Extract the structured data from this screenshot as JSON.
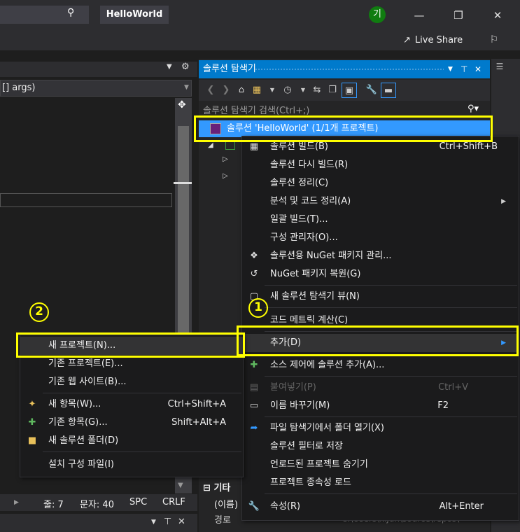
{
  "window": {
    "title": "HelloWorld",
    "user_initial": "기",
    "live_share": "Live Share",
    "minimize": "—",
    "restore": "❐",
    "close": "✕"
  },
  "editor": {
    "nav_combo": "[] args)",
    "status": {
      "line": "줄: 7",
      "char": "문자: 40",
      "spc": "SPC",
      "crlf": "CRLF"
    }
  },
  "solution_explorer": {
    "title": "솔루션 탐색기",
    "search_placeholder": "솔루션 탐색기 검색(Ctrl+;)",
    "solution_label": "솔루션 'HelloWorld' (1/1개 프로젝트)",
    "properties": {
      "group": "기타",
      "name_label": "(이름)",
      "path_label": "경로",
      "path_value": "C:\\Users\\kijun\\source\\repos\\"
    }
  },
  "context_menu": {
    "items": [
      {
        "label": "솔루션 빌드(B)",
        "shortcut": "Ctrl+Shift+B",
        "icon": "build-icon"
      },
      {
        "label": "솔루션 다시 빌드(R)",
        "shortcut": ""
      },
      {
        "label": "솔루션 정리(C)",
        "shortcut": ""
      },
      {
        "label": "분석 및 코드 정리(A)",
        "shortcut": "",
        "submenu": true
      },
      {
        "label": "일괄 빌드(T)...",
        "shortcut": ""
      },
      {
        "label": "구성 관리자(O)...",
        "shortcut": ""
      },
      {
        "label": "솔루션용 NuGet 패키지 관리...",
        "shortcut": "",
        "icon": "nuget-icon"
      },
      {
        "label": "NuGet 패키지 복원(G)",
        "shortcut": "",
        "icon": "nuget-restore-icon"
      },
      {
        "label": "새 솔루션 탐색기 뷰(N)",
        "shortcut": "",
        "icon": "new-view-icon"
      },
      {
        "label": "코드 메트릭 계산(C)",
        "shortcut": ""
      },
      {
        "label": "추가(D)",
        "shortcut": "",
        "submenu": true
      },
      {
        "label": "소스 제어에 솔루션 추가(A)...",
        "shortcut": "",
        "icon": "source-control-icon"
      },
      {
        "label": "붙여넣기(P)",
        "shortcut": "Ctrl+V",
        "disabled": true,
        "icon": "paste-icon"
      },
      {
        "label": "이름 바꾸기(M)",
        "shortcut": "F2",
        "icon": "rename-icon"
      },
      {
        "label": "파일 탐색기에서 폴더 열기(X)",
        "shortcut": "",
        "icon": "open-folder-icon"
      },
      {
        "label": "솔루션 필터로 저장",
        "shortcut": ""
      },
      {
        "label": "언로드된 프로젝트 숨기기",
        "shortcut": ""
      },
      {
        "label": "프로젝트 종속성 로드",
        "shortcut": ""
      },
      {
        "label": "속성(R)",
        "shortcut": "Alt+Enter",
        "icon": "wrench-icon"
      }
    ]
  },
  "add_submenu": {
    "items": [
      {
        "label": "새 프로젝트(N)...",
        "shortcut": ""
      },
      {
        "label": "기존 프로젝트(E)...",
        "shortcut": ""
      },
      {
        "label": "기존 웹 사이트(B)...",
        "shortcut": ""
      },
      {
        "label": "새 항목(W)...",
        "shortcut": "Ctrl+Shift+A"
      },
      {
        "label": "기존 항목(G)...",
        "shortcut": "Shift+Alt+A"
      },
      {
        "label": "새 솔루션 폴더(D)",
        "shortcut": ""
      },
      {
        "label": "설치 구성 파일(I)",
        "shortcut": ""
      }
    ]
  },
  "annotations": {
    "step1": "1",
    "step2": "2"
  },
  "colors": {
    "accent": "#007acc",
    "selection": "#3399ff",
    "callout": "#ffff00"
  }
}
